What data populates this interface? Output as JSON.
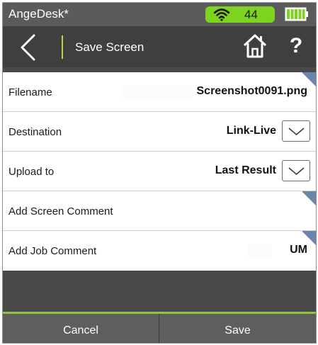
{
  "statusbar": {
    "app_title": "AngeDesk*",
    "wifi_level": "44",
    "wifi_icon": "wifi-icon",
    "battery_icon": "battery-icon",
    "accent_color": "#7ed321"
  },
  "header": {
    "back_icon": "chevron-left-icon",
    "title": "Save Screen",
    "home_icon": "home-icon",
    "help_label": "?"
  },
  "form": {
    "rows": [
      {
        "label": "Filename",
        "value": "Screenshot0091.png",
        "has_dropdown": false,
        "has_corner_marker": true
      },
      {
        "label": "Destination",
        "value": "Link-Live",
        "has_dropdown": true,
        "has_corner_marker": false
      },
      {
        "label": "Upload to",
        "value": "Last Result",
        "has_dropdown": true,
        "has_corner_marker": false
      },
      {
        "label": "Add Screen Comment",
        "value": "",
        "has_dropdown": false,
        "has_corner_marker": true
      },
      {
        "label": "Add Job Comment",
        "value": "UM",
        "has_dropdown": false,
        "has_corner_marker": true
      }
    ]
  },
  "footer": {
    "cancel_label": "Cancel",
    "save_label": "Save"
  },
  "colors": {
    "divider_accent": "#b8d64b",
    "footer_accent": "#8cc63f",
    "corner_marker": "#6a86aa"
  }
}
